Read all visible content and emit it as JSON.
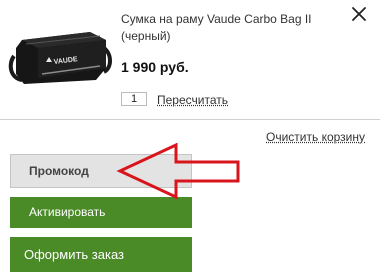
{
  "product": {
    "name": "Сумка на раму Vaude Carbo Bag II (черный)",
    "brand_logo": "VAUDE",
    "image_icon": "bike-frame-bag-image",
    "price": "1 990 руб.",
    "quantity": "1"
  },
  "actions": {
    "close_icon": "close-icon",
    "recalculate_label": "Пересчитать",
    "clear_cart_label": "Очистить корзину",
    "promo_label": "Промокод",
    "activate_label": "Активировать",
    "checkout_label": "Оформить заказ"
  },
  "colors": {
    "primary_button": "#4a8a27",
    "promo_button": "#e3e3e3",
    "annotation_arrow": "#d8141c"
  }
}
